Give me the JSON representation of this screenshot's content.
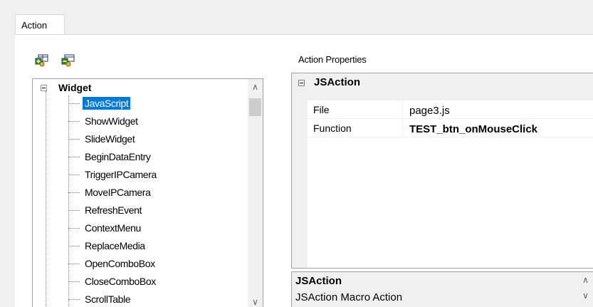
{
  "tabs": [
    {
      "label": "Action"
    }
  ],
  "toolbar": {
    "buttons": [
      {
        "icon": "add-action-icon"
      },
      {
        "icon": "remove-action-icon"
      }
    ]
  },
  "tree": {
    "root": {
      "label": "Widget",
      "expanded": true
    },
    "items": [
      {
        "label": "JavaScript",
        "selected": true
      },
      {
        "label": "ShowWidget"
      },
      {
        "label": "SlideWidget"
      },
      {
        "label": "BeginDataEntry"
      },
      {
        "label": "TriggerIPCamera"
      },
      {
        "label": "MoveIPCamera"
      },
      {
        "label": "RefreshEvent"
      },
      {
        "label": "ContextMenu"
      },
      {
        "label": "ReplaceMedia"
      },
      {
        "label": "OpenComboBox"
      },
      {
        "label": "CloseComboBox"
      },
      {
        "label": "ScrollTable"
      }
    ]
  },
  "properties": {
    "title": "Action Properties",
    "category": "JSAction",
    "rows": [
      {
        "name": "File",
        "value": "page3.js"
      },
      {
        "name": "Function",
        "value": "TEST_btn_onMouseClick"
      }
    ]
  },
  "description": {
    "title": "JSAction",
    "text": "JSAction Macro Action"
  },
  "colors": {
    "selection": "#0078d7",
    "background": "#f0f0f0",
    "border": "#a0a0a0"
  }
}
